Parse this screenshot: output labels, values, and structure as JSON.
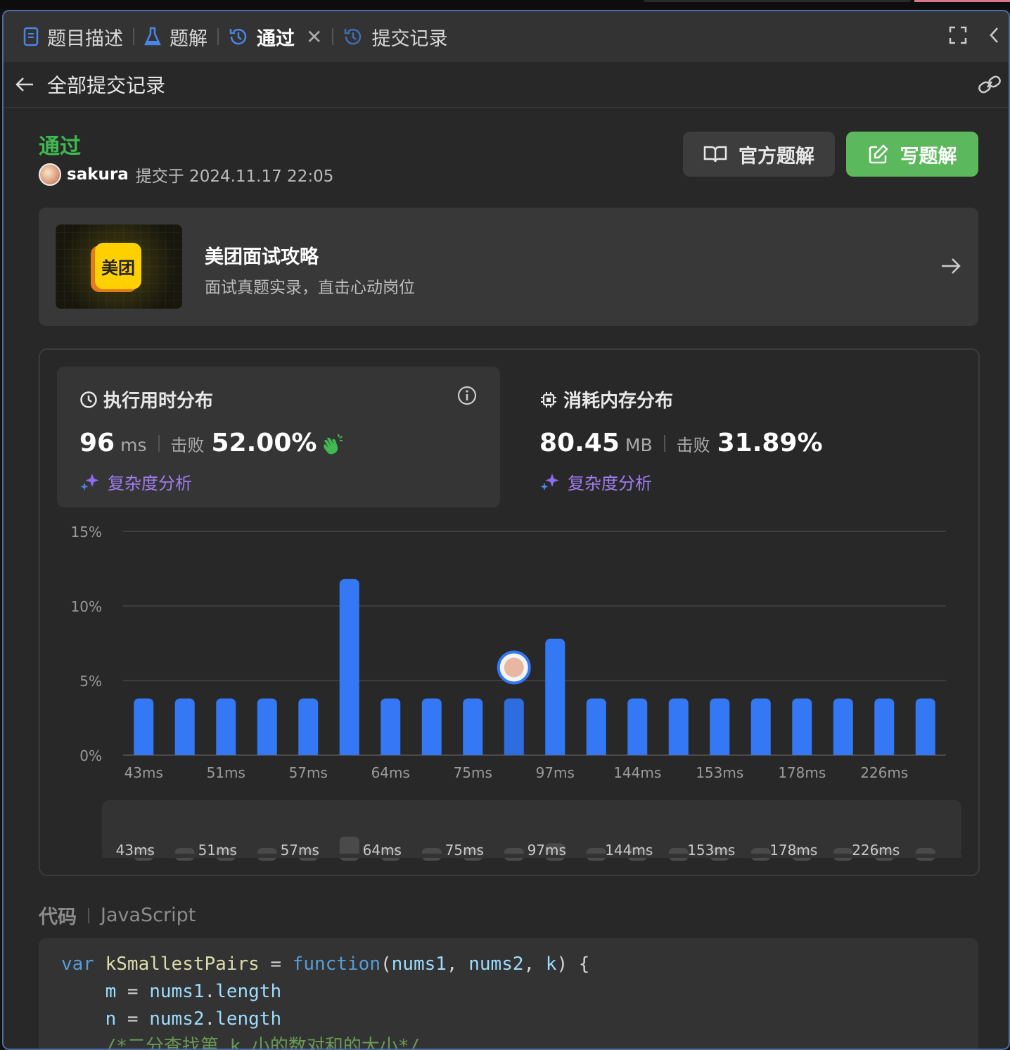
{
  "tabs": [
    {
      "label": "题目描述",
      "icon": "document-icon"
    },
    {
      "label": "题解",
      "icon": "flask-icon"
    },
    {
      "label": "通过",
      "icon": "history-icon",
      "active": true,
      "closable": true
    },
    {
      "label": "提交记录",
      "icon": "history-icon"
    }
  ],
  "header": {
    "back_label": "全部提交记录"
  },
  "submission": {
    "status": "通过",
    "user": "sakura",
    "submitted_text": "提交于 2024.11.17 22:05"
  },
  "actions": {
    "official": "官方题解",
    "write": "写题解"
  },
  "promo": {
    "logo_text": "美团",
    "title": "美团面试攻略",
    "subtitle": "面试真题实录，直击心动岗位"
  },
  "runtime": {
    "title": "执行用时分布",
    "value": "96",
    "unit": "ms",
    "beat_label": "击败",
    "beat_pct": "52.00%",
    "analysis": "复杂度分析"
  },
  "memory": {
    "title": "消耗内存分布",
    "value": "80.45",
    "unit": "MB",
    "beat_label": "击败",
    "beat_pct": "31.89%",
    "analysis": "复杂度分析"
  },
  "colors": {
    "accent_green": "#5cb85c",
    "status_green": "#3fb950",
    "bar_blue": "#3478f6",
    "analysis_purple": "#a07cf0"
  },
  "chart_data": {
    "type": "bar",
    "yticks": [
      "15%",
      "10%",
      "5%",
      "0%"
    ],
    "ylim": [
      0,
      15
    ],
    "xtick_labels": [
      "43ms",
      "51ms",
      "57ms",
      "64ms",
      "75ms",
      "97ms",
      "144ms",
      "153ms",
      "178ms",
      "226ms"
    ],
    "values": [
      3.8,
      3.8,
      3.8,
      3.8,
      3.8,
      11.8,
      3.8,
      3.8,
      3.8,
      3.8,
      7.8,
      3.8,
      3.8,
      3.8,
      3.8,
      3.8,
      3.8,
      3.8,
      3.8,
      3.8
    ],
    "highlight_index": 9,
    "grid": true,
    "brush_labels": [
      "43ms",
      "51ms",
      "57ms",
      "64ms",
      "75ms",
      "97ms",
      "144ms",
      "153ms",
      "178ms",
      "226ms"
    ]
  },
  "code": {
    "label": "代码",
    "language": "JavaScript",
    "lines": [
      "var kSmallestPairs = function(nums1, nums2, k) {",
      "    m = nums1.length",
      "    n = nums2.length",
      "    /*二分查找第 k 小的数对和的大小*/"
    ]
  }
}
